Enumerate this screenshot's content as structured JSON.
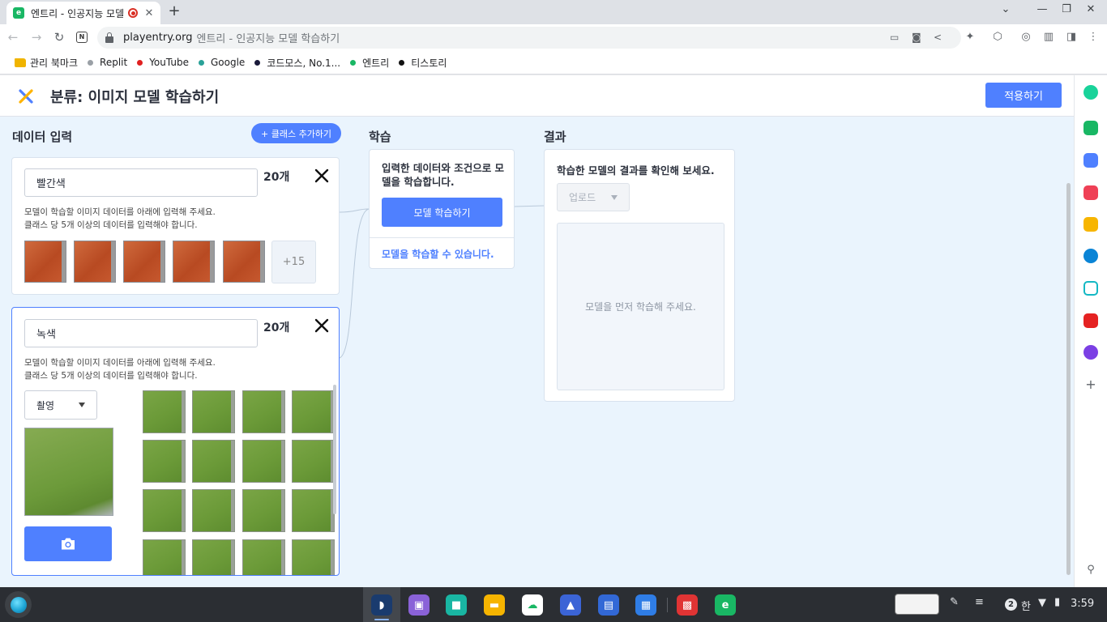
{
  "browser": {
    "tab_title": "엔트리 - 인공지능 모델 학",
    "url_host": "playentry.org",
    "url_title": "엔트리 - 인공지능 모델 학습하기"
  },
  "bookmarks": [
    {
      "label": "관리 북마크",
      "color": "#f0b400",
      "folder": true
    },
    {
      "label": "Replit",
      "color": "#9aa0a6"
    },
    {
      "label": "YouTube",
      "color": "#e02020"
    },
    {
      "label": "Google",
      "color": "#2aa198"
    },
    {
      "label": "코드모스, No.1...",
      "color": "#1a1a3a"
    },
    {
      "label": "엔트리",
      "color": "#19b764"
    },
    {
      "label": "티스토리",
      "color": "#111111"
    }
  ],
  "header": {
    "title": "분류: 이미지 모델 학습하기",
    "apply_label": "적용하기"
  },
  "input_section": {
    "title": "데이터 입력",
    "add_class_label": "+ 클래스 추가하기"
  },
  "classes": [
    {
      "name": "빨간색",
      "count": "20개",
      "desc_line1": "모델이 학습할 이미지 데이터를 아래에 입력해 주세요.",
      "desc_line2": "클래스 당 5개 이상의 데이터를 입력해야 합니다.",
      "more_label": "+15"
    },
    {
      "name": "녹색",
      "count": "20개",
      "desc_line1": "모델이 학습할 이미지 데이터를 아래에 입력해 주세요.",
      "desc_line2": "클래스 당 5개 이상의 데이터를 입력해야 합니다.",
      "source_label": "촬영"
    }
  ],
  "train_section": {
    "title": "학습",
    "text": "입력한 데이터와 조건으로 모델을 학습합니다.",
    "button_label": "모델 학습하기",
    "status": "모델을 학습할 수 있습니다."
  },
  "result_section": {
    "title": "결과",
    "text": "학습한 모델의 결과를 확인해 보세요.",
    "upload_label": "업로드",
    "placeholder": "모델을 먼저 학습해 주세요."
  },
  "shelf": {
    "notification_count": "2",
    "ime": "한",
    "time": "3:59"
  },
  "colors": {
    "accent": "#4f80ff",
    "workspace_bg": "#eaf4fd"
  }
}
